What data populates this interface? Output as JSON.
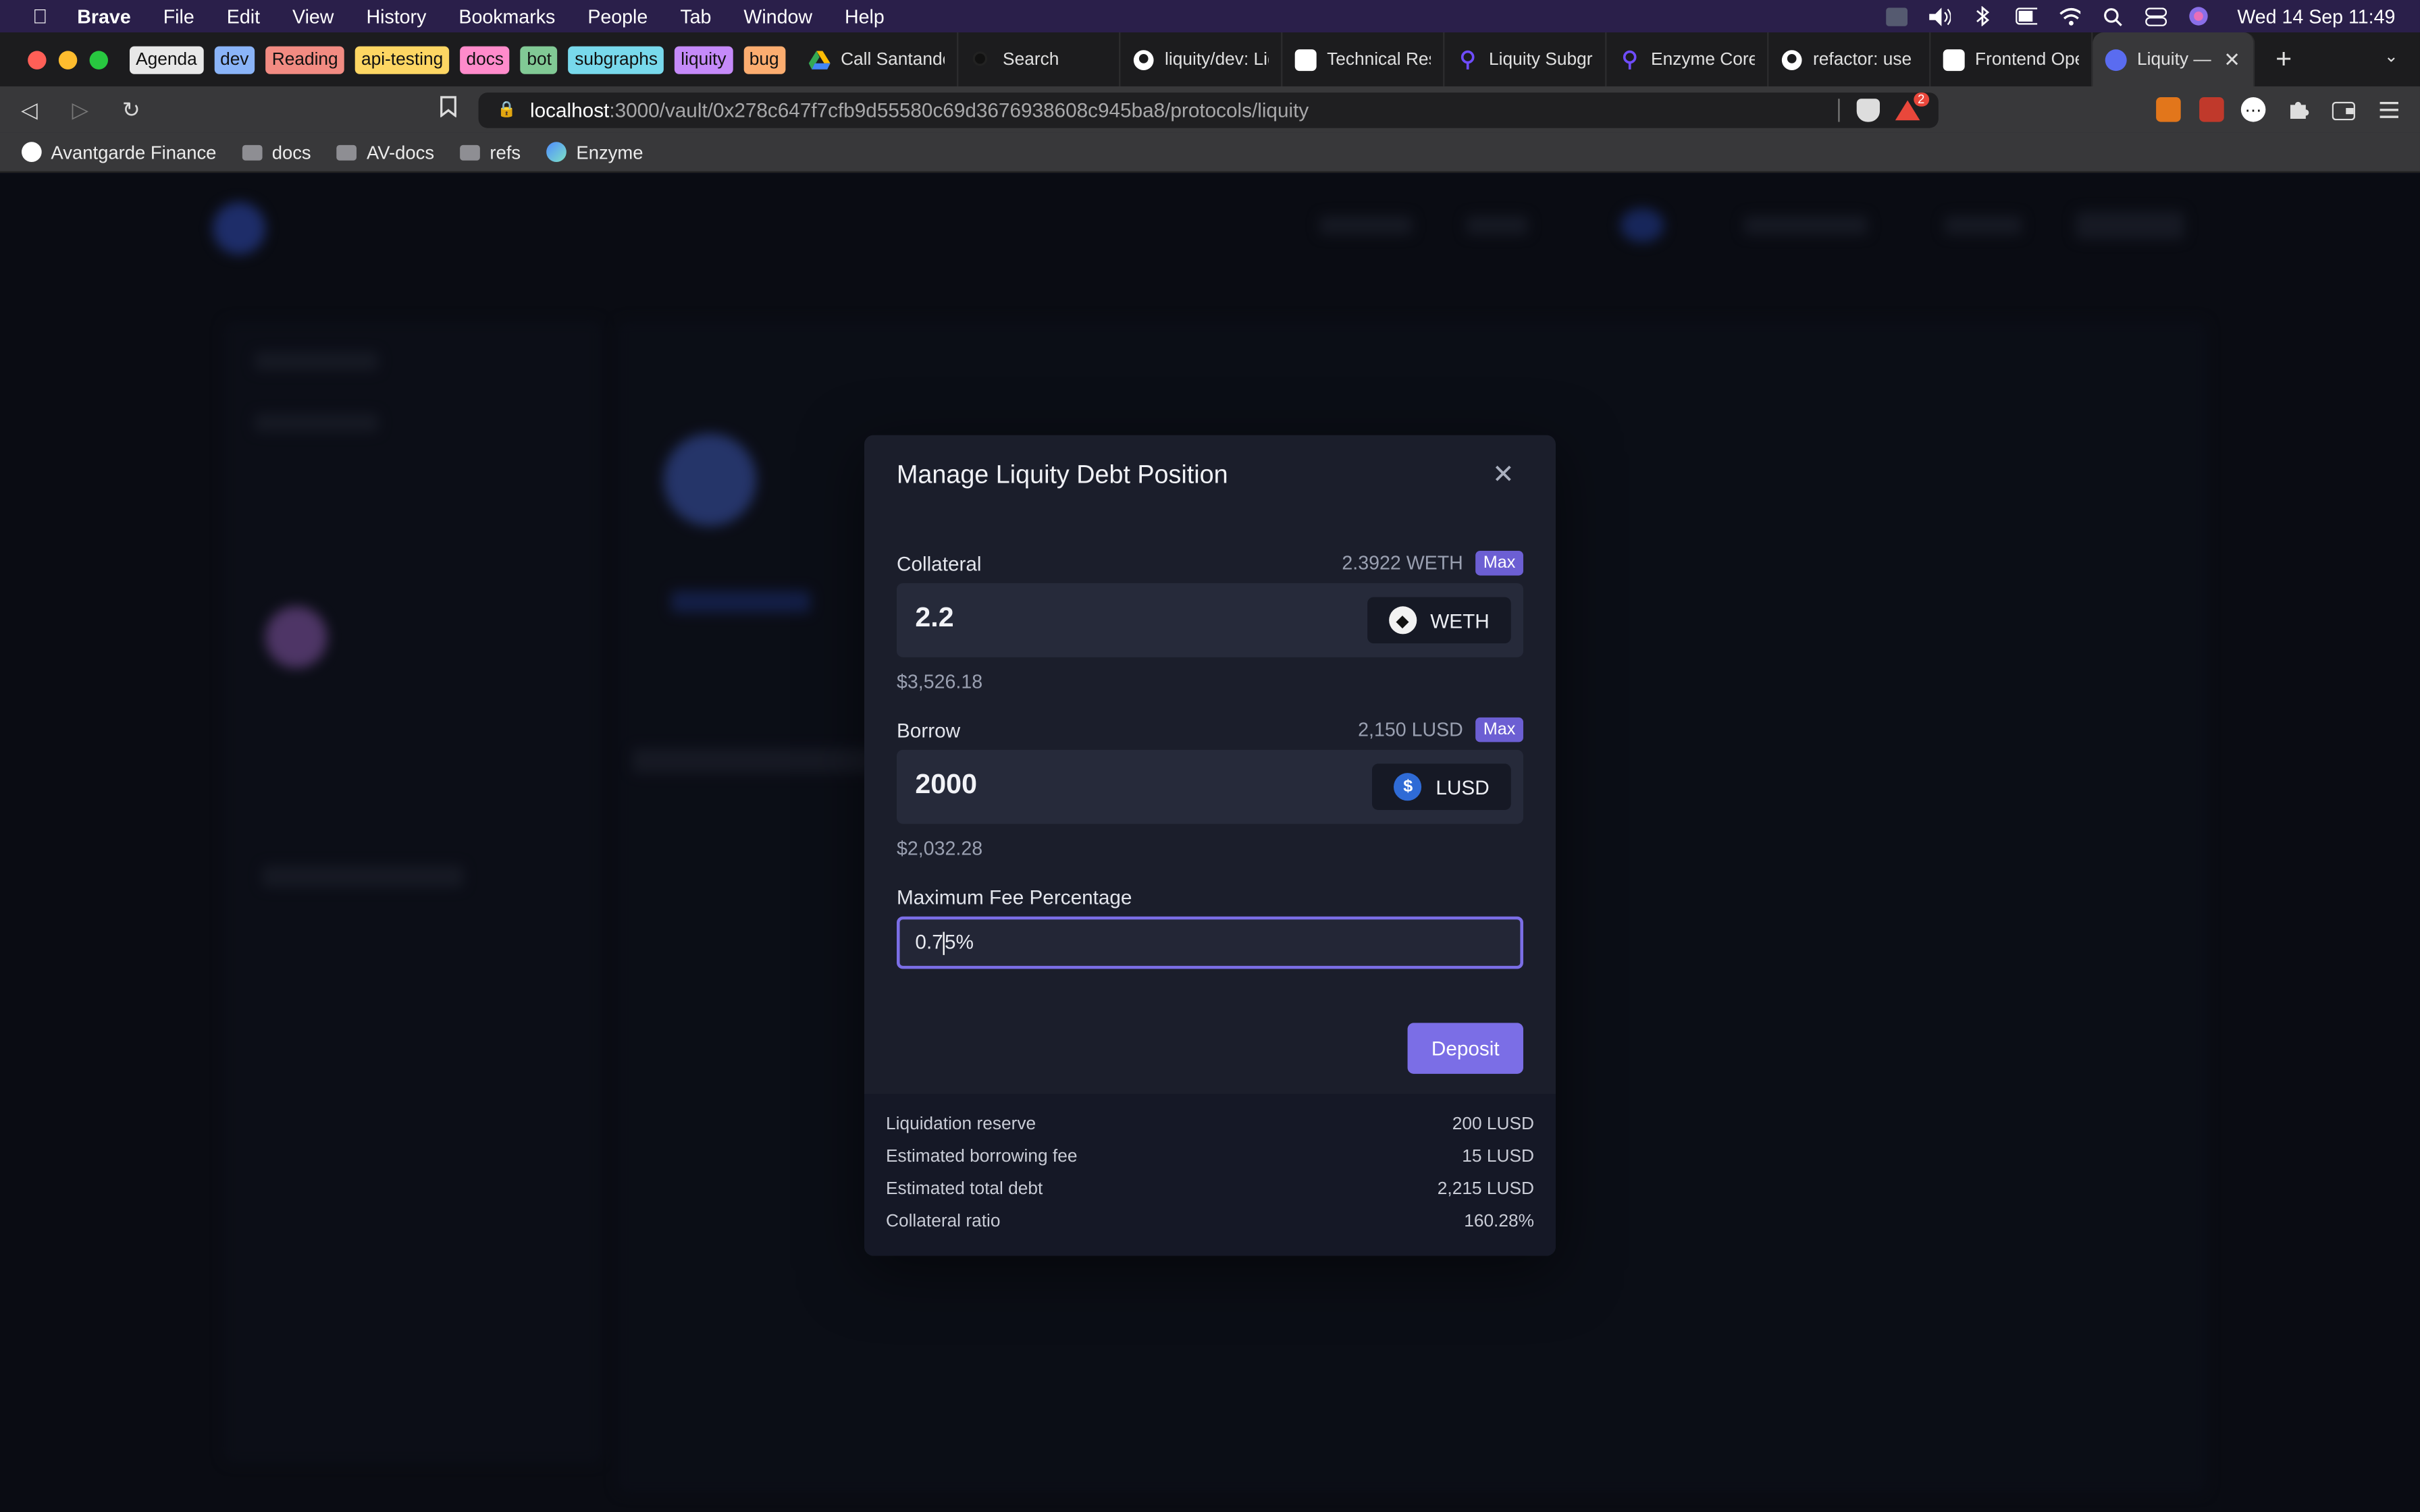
{
  "menubar": {
    "app": "Brave",
    "items": [
      "File",
      "Edit",
      "View",
      "History",
      "Bookmarks",
      "People",
      "Tab",
      "Window",
      "Help"
    ],
    "clock": "Wed 14 Sep  11:49"
  },
  "tab_groups": [
    {
      "label": "Agenda",
      "color": "#e8e8e8"
    },
    {
      "label": "dev",
      "color": "#8ab4f8"
    },
    {
      "label": "Reading",
      "color": "#f28b82"
    },
    {
      "label": "api-testing",
      "color": "#fdd663"
    },
    {
      "label": "docs",
      "color": "#ff8bcb"
    },
    {
      "label": "bot",
      "color": "#81c995"
    },
    {
      "label": "subgraphs",
      "color": "#78d9ec"
    },
    {
      "label": "liquity",
      "color": "#c58af9"
    },
    {
      "label": "bug",
      "color": "#fcad70"
    }
  ],
  "tabs": [
    {
      "label": "Call Santander",
      "icon": "google-drive-icon"
    },
    {
      "label": "Search",
      "icon": "search-icon"
    },
    {
      "label": "liquity/dev: Liq",
      "icon": "github-icon"
    },
    {
      "label": "Technical Reso",
      "icon": "document-icon"
    },
    {
      "label": "Liquity Subgra",
      "icon": "subgraph-icon"
    },
    {
      "label": "Enzyme Core D",
      "icon": "subgraph-icon"
    },
    {
      "label": "refactor: use rl",
      "icon": "github-icon"
    },
    {
      "label": "Frontend Oper",
      "icon": "document-icon"
    }
  ],
  "active_tab": {
    "label": "Liquity — I"
  },
  "url": {
    "host": "localhost",
    "path": ":3000/vault/0x278c647f7cfb9d55580c69d3676938608c945ba8/protocols/liquity"
  },
  "rewards_badge": "2",
  "bookmarks": [
    {
      "label": "Avantgarde Finance",
      "icon": "github-icon"
    },
    {
      "label": "docs",
      "icon": "folder-icon"
    },
    {
      "label": "AV-docs",
      "icon": "folder-icon"
    },
    {
      "label": "refs",
      "icon": "folder-icon"
    },
    {
      "label": "Enzyme",
      "icon": "enzyme-icon"
    }
  ],
  "modal": {
    "title": "Manage Liquity Debt Position",
    "collateral": {
      "label": "Collateral",
      "balance": "2.3922 WETH",
      "max": "Max",
      "value": "2.2",
      "token": "WETH",
      "usd": "$3,526.18"
    },
    "borrow": {
      "label": "Borrow",
      "balance": "2,150 LUSD",
      "max": "Max",
      "value": "2000",
      "token": "LUSD",
      "usd": "$2,032.28"
    },
    "fee": {
      "label": "Maximum Fee Percentage",
      "value_before_caret": "0.7",
      "value_after_caret": "5%"
    },
    "deposit": "Deposit",
    "summary": [
      {
        "label": "Liquidation reserve",
        "value": "200 LUSD"
      },
      {
        "label": "Estimated borrowing fee",
        "value": "15 LUSD"
      },
      {
        "label": "Estimated total debt",
        "value": "2,215 LUSD"
      },
      {
        "label": "Collateral ratio",
        "value": "160.28%"
      }
    ]
  },
  "colors": {
    "accent": "#7b6ee6",
    "modal_bg": "#1b1e2b",
    "page_bg": "#0e1019"
  }
}
